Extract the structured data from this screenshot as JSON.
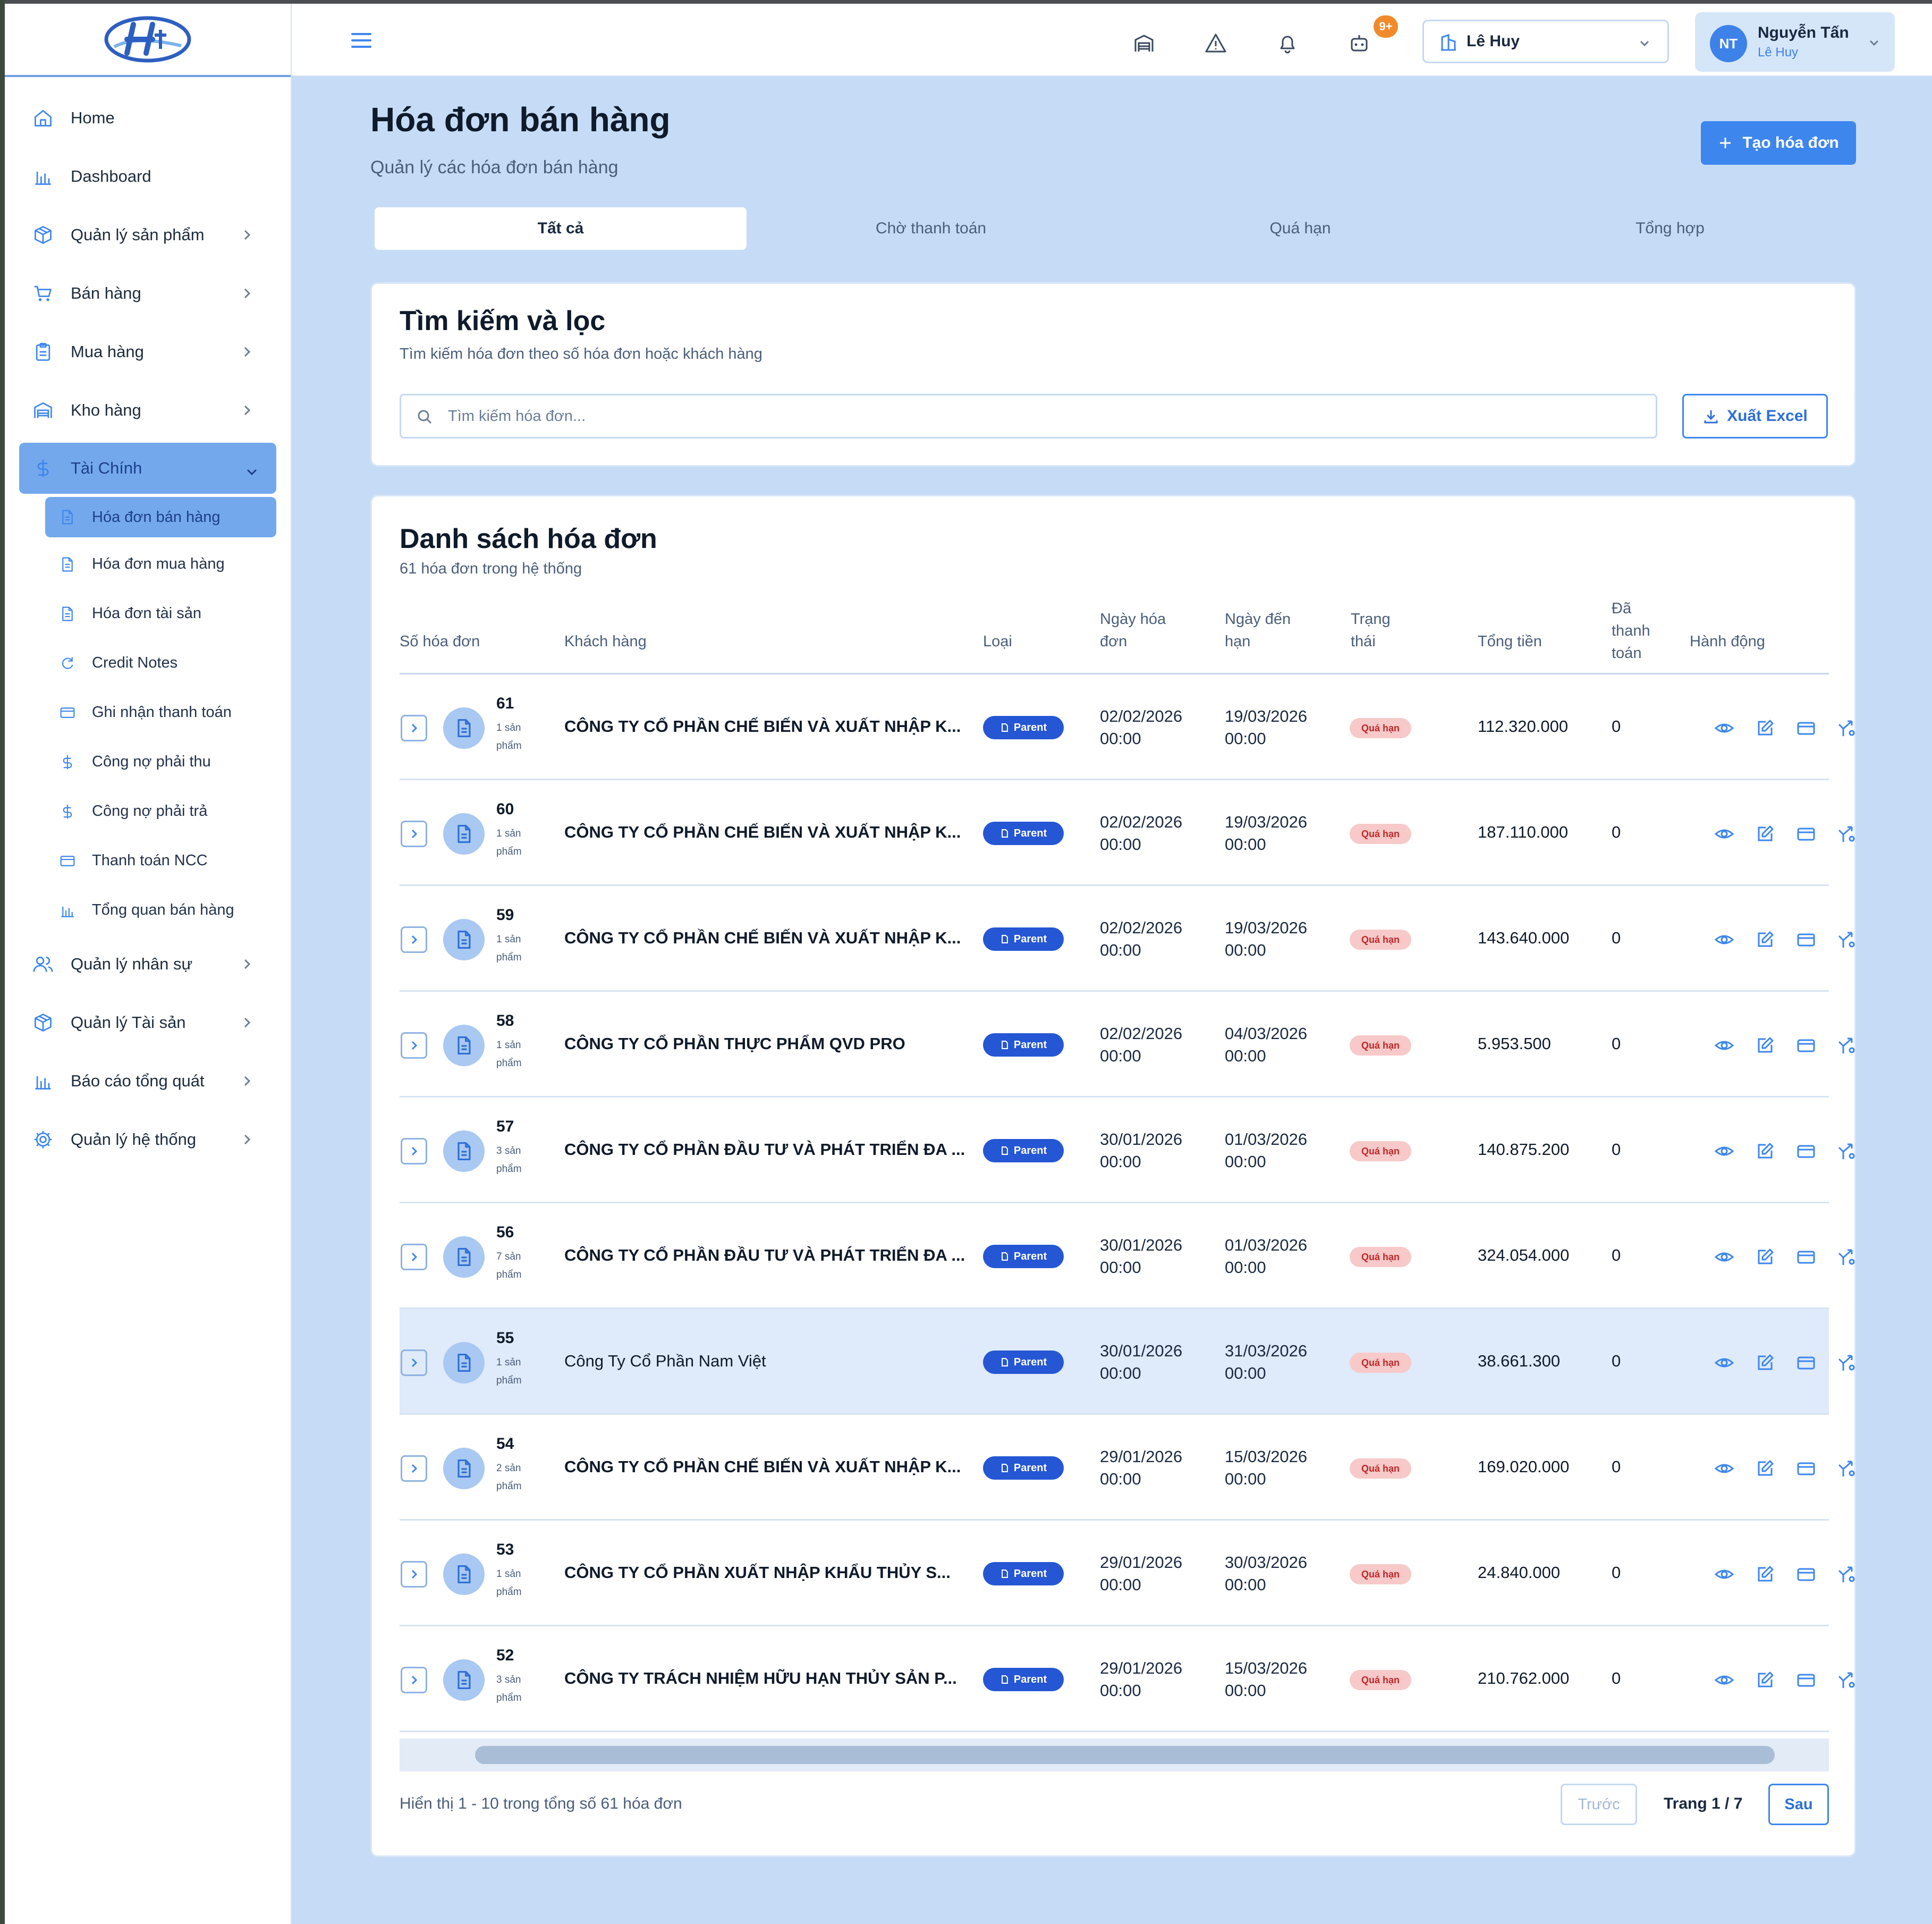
{
  "sidebar": {
    "items": [
      {
        "label": "Home",
        "icon": "home-icon"
      },
      {
        "label": "Dashboard",
        "icon": "bar-chart-icon"
      },
      {
        "label": "Quản lý sản phẩm",
        "icon": "package-icon"
      },
      {
        "label": "Bán hàng",
        "icon": "cart-icon"
      },
      {
        "label": "Mua hàng",
        "icon": "clipboard-icon"
      },
      {
        "label": "Kho hàng",
        "icon": "warehouse-icon"
      },
      {
        "label": "Tài Chính",
        "icon": "dollar-icon"
      }
    ],
    "sub_items": [
      {
        "label": "Hóa đơn bán hàng",
        "icon": "file-icon"
      },
      {
        "label": "Hóa đơn mua hàng",
        "icon": "file-icon"
      },
      {
        "label": "Hóa đơn tài sản",
        "icon": "file-icon"
      },
      {
        "label": "Credit Notes",
        "icon": "refresh-icon"
      },
      {
        "label": "Ghi nhận thanh toán",
        "icon": "card-icon"
      },
      {
        "label": "Công nợ phải thu",
        "icon": "dollar-icon"
      },
      {
        "label": "Công nợ phải trả",
        "icon": "dollar-icon"
      },
      {
        "label": "Thanh toán NCC",
        "icon": "card-icon"
      },
      {
        "label": "Tổng quan bán hàng",
        "icon": "bar-chart-icon"
      }
    ],
    "items_after": [
      {
        "label": "Quản lý nhân sự",
        "icon": "users-icon"
      },
      {
        "label": "Quản lý Tài sản",
        "icon": "package-icon"
      },
      {
        "label": "Báo cáo tổng quát",
        "icon": "bar-chart-icon"
      },
      {
        "label": "Quản lý hệ thống",
        "icon": "gear-icon"
      }
    ]
  },
  "topbar": {
    "notification_badge": "9+",
    "branch": "Lê Huy",
    "user_initials": "NT",
    "user_name": "Nguyễn Tấn",
    "user_role": "Lê Huy"
  },
  "header": {
    "title": "Hóa đơn bán hàng",
    "subtitle": "Quản lý các hóa đơn bán hàng",
    "create_label": "Tạo hóa đơn"
  },
  "tabs": [
    "Tất cả",
    "Chờ thanh toán",
    "Quá hạn",
    "Tổng hợp"
  ],
  "search": {
    "title": "Tìm kiếm và lọc",
    "subtitle": "Tìm kiếm hóa đơn theo số hóa đơn hoặc khách hàng",
    "placeholder": "Tìm kiếm hóa đơn...",
    "export_label": "Xuất Excel"
  },
  "list": {
    "title": "Danh sách hóa đơn",
    "subtitle": "61 hóa đơn trong hệ thống",
    "columns": [
      "Số hóa đơn",
      "Khách hàng",
      "Loại",
      "Ngày hóa đơn",
      "Ngày đến hạn",
      "Trạng thái",
      "Tổng tiền",
      "Đã thanh toán",
      "Hành động"
    ],
    "rows": [
      {
        "no": "61",
        "items": "1 sản phẩm",
        "customer": "CÔNG TY CỔ PHẦN CHẾ BIẾN VÀ XUẤT NHẬP K...",
        "type": "Parent",
        "inv_date": "02/02/2026",
        "inv_time": "00:00",
        "due_date": "19/03/2026",
        "due_time": "00:00",
        "status": "Quá hạn",
        "total": "112.320.000",
        "paid": "0"
      },
      {
        "no": "60",
        "items": "1 sản phẩm",
        "customer": "CÔNG TY CỔ PHẦN CHẾ BIẾN VÀ XUẤT NHẬP K...",
        "type": "Parent",
        "inv_date": "02/02/2026",
        "inv_time": "00:00",
        "due_date": "19/03/2026",
        "due_time": "00:00",
        "status": "Quá hạn",
        "total": "187.110.000",
        "paid": "0"
      },
      {
        "no": "59",
        "items": "1 sản phẩm",
        "customer": "CÔNG TY CỔ PHẦN CHẾ BIẾN VÀ XUẤT NHẬP K...",
        "type": "Parent",
        "inv_date": "02/02/2026",
        "inv_time": "00:00",
        "due_date": "19/03/2026",
        "due_time": "00:00",
        "status": "Quá hạn",
        "total": "143.640.000",
        "paid": "0"
      },
      {
        "no": "58",
        "items": "1 sản phẩm",
        "customer": "CÔNG TY CỔ PHẦN THỰC PHẨM QVD PRO",
        "type": "Parent",
        "inv_date": "02/02/2026",
        "inv_time": "00:00",
        "due_date": "04/03/2026",
        "due_time": "00:00",
        "status": "Quá hạn",
        "total": "5.953.500",
        "paid": "0"
      },
      {
        "no": "57",
        "items": "3 sản phẩm",
        "customer": "CÔNG TY CỔ PHẦN ĐẦU TƯ VÀ PHÁT TRIỂN ĐA ...",
        "type": "Parent",
        "inv_date": "30/01/2026",
        "inv_time": "00:00",
        "due_date": "01/03/2026",
        "due_time": "00:00",
        "status": "Quá hạn",
        "total": "140.875.200",
        "paid": "0"
      },
      {
        "no": "56",
        "items": "7 sản phẩm",
        "customer": "CÔNG TY CỔ PHẦN ĐẦU TƯ VÀ PHÁT TRIỂN ĐA ...",
        "type": "Parent",
        "inv_date": "30/01/2026",
        "inv_time": "00:00",
        "due_date": "01/03/2026",
        "due_time": "00:00",
        "status": "Quá hạn",
        "total": "324.054.000",
        "paid": "0"
      },
      {
        "no": "55",
        "items": "1 sản phẩm",
        "customer": "Công Ty Cổ Phần Nam Việt",
        "type": "Parent",
        "inv_date": "30/01/2026",
        "inv_time": "00:00",
        "due_date": "31/03/2026",
        "due_time": "00:00",
        "status": "Quá hạn",
        "total": "38.661.300",
        "paid": "0"
      },
      {
        "no": "54",
        "items": "2 sản phẩm",
        "customer": "CÔNG TY CỔ PHẦN CHẾ BIẾN VÀ XUẤT NHẬP K...",
        "type": "Parent",
        "inv_date": "29/01/2026",
        "inv_time": "00:00",
        "due_date": "15/03/2026",
        "due_time": "00:00",
        "status": "Quá hạn",
        "total": "169.020.000",
        "paid": "0"
      },
      {
        "no": "53",
        "items": "1 sản phẩm",
        "customer": "CÔNG TY CỔ PHẦN XUẤT NHẬP KHẨU THỦY S...",
        "type": "Parent",
        "inv_date": "29/01/2026",
        "inv_time": "00:00",
        "due_date": "30/03/2026",
        "due_time": "00:00",
        "status": "Quá hạn",
        "total": "24.840.000",
        "paid": "0"
      },
      {
        "no": "52",
        "items": "3 sản phẩm",
        "customer": "CÔNG TY TRÁCH NHIỆM HỮU HẠN THỦY SẢN P...",
        "type": "Parent",
        "inv_date": "29/01/2026",
        "inv_time": "00:00",
        "due_date": "15/03/2026",
        "due_time": "00:00",
        "status": "Quá hạn",
        "total": "210.762.000",
        "paid": "0"
      }
    ]
  },
  "pagination": {
    "summary": "Hiển thị 1 - 10 trong tổng số 61 hóa đơn",
    "prev_label": "Trước",
    "page_label": "Trang 1 / 7",
    "next_label": "Sau"
  },
  "colors": {
    "accent": "#3d86ee",
    "active_nav": "#74a8ec",
    "type_badge": "#2556d4",
    "overdue_bg": "#f7c9c9",
    "overdue_text": "#c22828",
    "page_bg": "#c6dcf6"
  }
}
